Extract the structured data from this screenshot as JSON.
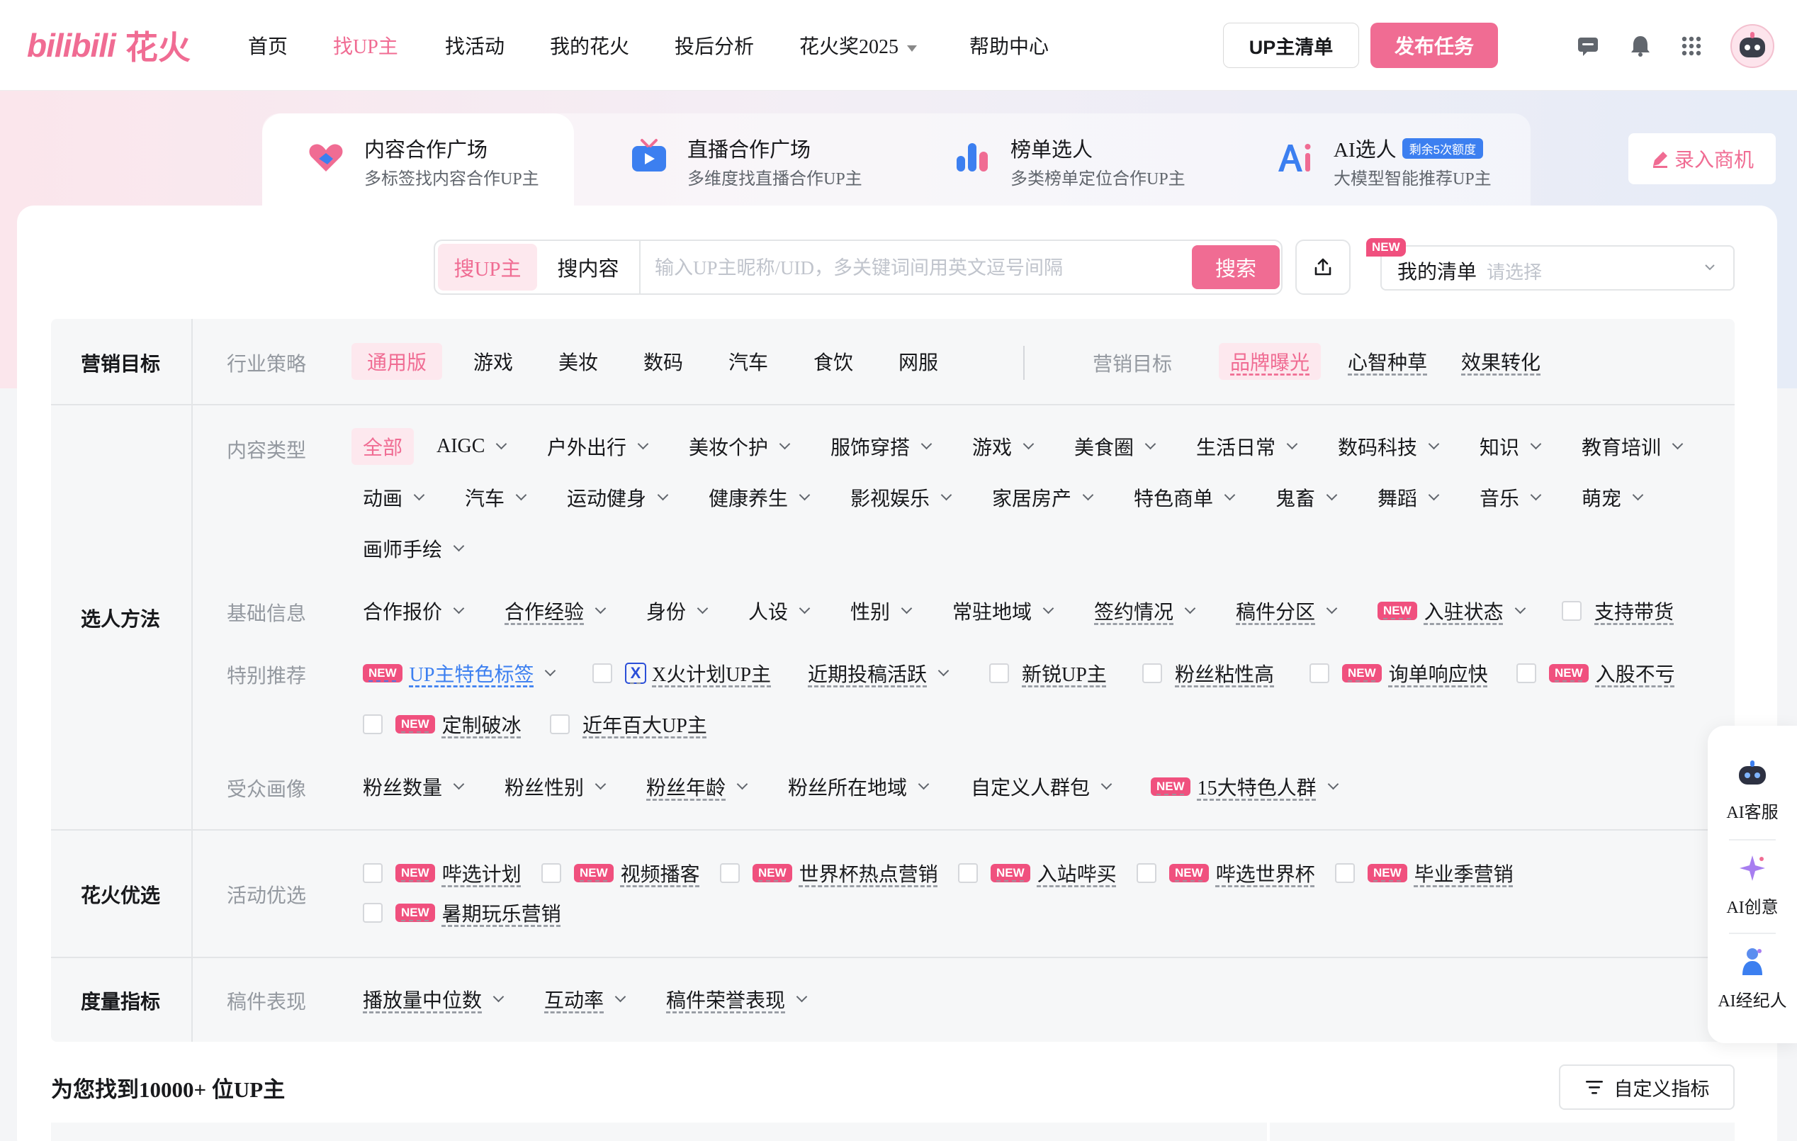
{
  "brand": {
    "logo_text": "bilibili",
    "logo_sub": "花火"
  },
  "nav": {
    "items": [
      "首页",
      "找UP主",
      "找活动",
      "我的花火",
      "投后分析",
      "花火奖2025",
      "帮助中心"
    ],
    "up_list_btn": "UP主清单",
    "publish_btn": "发布任务"
  },
  "categories": [
    {
      "title": "内容合作广场",
      "desc": "多标签找内容合作UP主"
    },
    {
      "title": "直播合作广场",
      "desc": "多维度找直播合作UP主"
    },
    {
      "title": "榜单选人",
      "desc": "多类榜单定位合作UP主"
    },
    {
      "title": "AI选人",
      "badge": "剩余5次额度",
      "desc": "大模型智能推荐UP主"
    }
  ],
  "enter_opportunity": "录入商机",
  "search": {
    "tab_up": "搜UP主",
    "tab_content": "搜内容",
    "placeholder": "输入UP主昵称/UID，多关键词间用英文逗号间隔",
    "button": "搜索",
    "mylist_label": "我的清单",
    "mylist_placeholder": "请选择",
    "new": "NEW"
  },
  "filters": {
    "marketing": {
      "label": "营销目标",
      "industry_label": "行业策略",
      "industry_options": [
        "通用版",
        "游戏",
        "美妆",
        "数码",
        "汽车",
        "食饮",
        "网服"
      ],
      "goal_label": "营销目标",
      "goal_options": [
        "品牌曝光",
        "心智种草",
        "效果转化"
      ]
    },
    "selection": {
      "label": "选人方法",
      "content_type_label": "内容类型",
      "content_types_row1": [
        "全部",
        "AIGC",
        "户外出行",
        "美妆个护",
        "服饰穿搭",
        "游戏",
        "美食圈",
        "生活日常",
        "数码科技",
        "知识",
        "教育培训"
      ],
      "content_types_row2": [
        "动画",
        "汽车",
        "运动健身",
        "健康养生",
        "影视娱乐",
        "家居房产",
        "特色商单",
        "鬼畜",
        "舞蹈",
        "音乐",
        "萌宠"
      ],
      "content_types_row3": [
        "画师手绘"
      ],
      "basic_label": "基础信息",
      "basic_options": [
        "合作报价",
        "合作经验",
        "身份",
        "人设",
        "性别",
        "常驻地域",
        "签约情况",
        "稿件分区",
        "入驻状态",
        "支持带货"
      ],
      "special_label": "特别推荐",
      "special_options": [
        "UP主特色标签",
        "X火计划UP主",
        "近期投稿活跃",
        "新锐UP主",
        "粉丝粘性高",
        "询单响应快",
        "入股不亏",
        "定制破冰",
        "近年百大UP主"
      ],
      "audience_label": "受众画像",
      "audience_options": [
        "粉丝数量",
        "粉丝性别",
        "粉丝年龄",
        "粉丝所在地域",
        "自定义人群包",
        "15大特色人群"
      ]
    },
    "huahuo": {
      "label": "花火优选",
      "activity_label": "活动优选",
      "activity_options": [
        "哔选计划",
        "视频播客",
        "世界杯热点营销",
        "入站哔买",
        "哔选世界杯",
        "毕业季营销",
        "暑期玩乐营销"
      ]
    },
    "metrics": {
      "label": "度量指标",
      "perf_label": "稿件表现",
      "perf_options": [
        "播放量中位数",
        "互动率",
        "稿件荣誉表现"
      ]
    }
  },
  "results": {
    "title": "为您找到10000+ 位UP主",
    "custom_btn": "自定义指标"
  },
  "ai_panel": {
    "items": [
      "AI客服",
      "AI创意",
      "AI经纪人"
    ]
  },
  "colors": {
    "accent": "#f06c93",
    "new_badge": "#f0507e",
    "link_blue": "#3c7ff0"
  }
}
